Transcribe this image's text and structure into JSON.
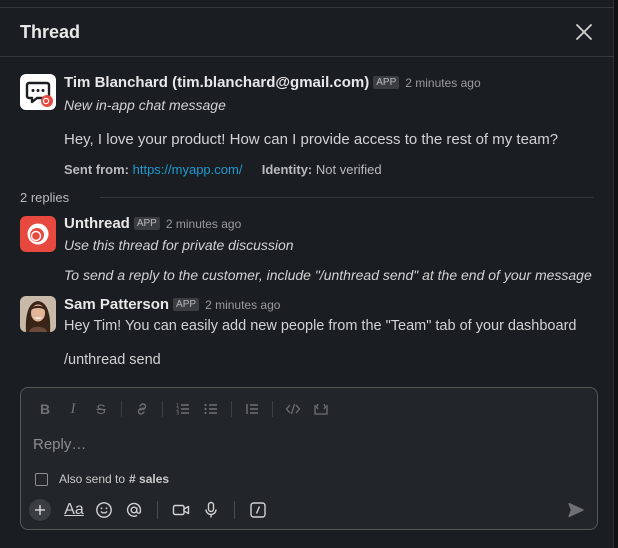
{
  "header": {
    "title": "Thread"
  },
  "parent": {
    "name": "Tim Blanchard (tim.blanchard@gmail.com)",
    "badge": "APP",
    "time": "2 minutes ago",
    "subtitle": "New in-app chat message",
    "body": "Hey, I love your product! How can I provide access to the rest of my team?",
    "sent_from_label": "Sent from:",
    "sent_from_url": "https://myapp.com/",
    "identity_label": "Identity:",
    "identity_value": "Not verified"
  },
  "replies": {
    "label": "2 replies"
  },
  "reply1": {
    "name": "Unthread",
    "badge": "APP",
    "time": "2 minutes ago",
    "line1": "Use this thread for private discussion",
    "line2": "To send a reply to the customer, include \"/unthread send\" at the end of your message"
  },
  "reply2": {
    "name": "Sam Patterson",
    "badge": "APP",
    "time": "2 minutes ago",
    "line1": "Hey Tim! You can easily add new people from the \"Team\" tab of your dashboard",
    "line2": "/unthread send"
  },
  "composer": {
    "placeholder": "Reply…",
    "also_send_label": "Also send to",
    "channel": "# sales",
    "format_buttons": [
      "bold-icon",
      "italic-icon",
      "strikethrough-icon",
      "link-icon",
      "ordered-list-icon",
      "bulleted-list-icon",
      "blockquote-icon",
      "code-icon",
      "code-block-icon"
    ],
    "bottom_buttons": [
      "plus-icon",
      "text-format-icon",
      "emoji-icon",
      "mention-icon",
      "video-icon",
      "microphone-icon",
      "slash-command-icon",
      "send-icon"
    ],
    "text_format_label": "Aa"
  },
  "colors": {
    "background": "#1a1d21",
    "link": "#1d9bd1",
    "unthread_red": "#e8493f",
    "divider": "#35373b"
  }
}
